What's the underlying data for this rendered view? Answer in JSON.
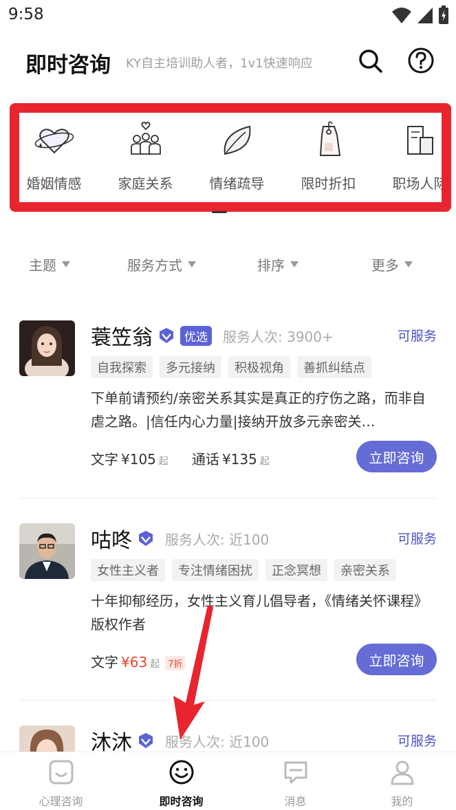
{
  "status_bar": {
    "time": "9:58"
  },
  "header": {
    "title": "即时咨询",
    "subtitle": "KY自主培训助人者，1v1快速响应"
  },
  "categories": [
    {
      "label": "婚姻情感",
      "icon": "heart-ring-icon"
    },
    {
      "label": "家庭关系",
      "icon": "family-icon"
    },
    {
      "label": "情绪疏导",
      "icon": "leaf-icon"
    },
    {
      "label": "限时折扣",
      "icon": "price-tag-icon"
    },
    {
      "label": "职场人际",
      "icon": "office-building-icon"
    }
  ],
  "filters": [
    {
      "label": "主题"
    },
    {
      "label": "服务方式"
    },
    {
      "label": "排序"
    },
    {
      "label": "更多"
    }
  ],
  "counselors": [
    {
      "name": "蓑笠翁",
      "badge": "优选",
      "served": "服务人次: 3900+",
      "status": "可服务",
      "tags": [
        "自我探索",
        "多元接纳",
        "积极视角",
        "善抓纠结点"
      ],
      "description": "下单前请预约/亲密关系其实是真正的疗伤之路，而非自虐之路。|信任内心力量|接纳开放多元亲密关…",
      "text_label": "文字",
      "text_price": "¥105",
      "text_suffix": "起",
      "call_label": "通话",
      "call_price": "¥135",
      "call_suffix": "起",
      "button": "立即咨询"
    },
    {
      "name": "咕咚",
      "served": "服务人次: 近100",
      "status": "可服务",
      "tags": [
        "女性主义者",
        "专注情绪困扰",
        "正念冥想",
        "亲密关系"
      ],
      "description": "十年抑郁经历，女性主义育儿倡导者，《情绪关怀课程》版权作者",
      "text_label": "文字",
      "text_price": "¥63",
      "text_suffix": "起",
      "discount": "7折",
      "button": "立即咨询"
    },
    {
      "name": "沐沐",
      "served": "服务人次: 近100",
      "status": "可服务"
    }
  ],
  "bottom_nav": [
    {
      "label": "心理咨询",
      "icon": "smile-box-icon",
      "active": false
    },
    {
      "label": "即时咨询",
      "icon": "smile-face-icon",
      "active": true
    },
    {
      "label": "消息",
      "icon": "chat-bubble-icon",
      "active": false
    },
    {
      "label": "我的",
      "icon": "person-icon",
      "active": false
    }
  ],
  "colors": {
    "accent": "#656cd6",
    "highlight_box": "#e8242f",
    "price_red": "#e8432e",
    "link_blue": "#4b53c9"
  }
}
